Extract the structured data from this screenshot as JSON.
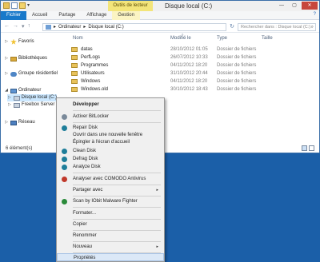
{
  "titlebar": {
    "context_tab": "Outils de lecteur",
    "title": "Disque local (C:)",
    "min": "—",
    "max": "▢",
    "close": "✕",
    "qa_drop": "▾"
  },
  "ribbon": {
    "tabs": [
      "Fichier",
      "Accueil",
      "Partage",
      "Affichage",
      "Gestion"
    ],
    "help": "?"
  },
  "address": {
    "back": "←",
    "forward": "→",
    "dropdown": "▾",
    "up": "↑",
    "path": [
      "Ordinateur",
      "Disque local (C:)"
    ],
    "separator": "▸",
    "refresh": "↻",
    "search_placeholder": "Rechercher dans : Disque local (C:)",
    "search_icon": "⌕"
  },
  "navpane": {
    "items": [
      {
        "chevron": "▷",
        "label": "Favoris",
        "icon": "star-icon"
      },
      {
        "chevron": "▷",
        "label": "Bibliothèques",
        "icon": "library-icon"
      },
      {
        "chevron": "▷",
        "label": "Groupe résidentiel",
        "icon": "homegroup-icon"
      },
      {
        "chevron": "◢",
        "label": "Ordinateur",
        "icon": "computer-icon"
      },
      {
        "chevron": "▷",
        "label": "Disque local (C:)",
        "icon": "drive-icon",
        "selected": true
      },
      {
        "chevron": "▷",
        "label": "Freebox Server",
        "icon": "network-drive-icon"
      },
      {
        "chevron": "▷",
        "label": "Réseau",
        "icon": "network-icon"
      }
    ]
  },
  "filelist": {
    "columns": [
      "Nom",
      "Modifié le",
      "Type",
      "Taille"
    ],
    "sort_arrow": "^",
    "rows": [
      {
        "name": "datas",
        "modified": "28/10/2012 01:05",
        "type": "Dossier de fichiers"
      },
      {
        "name": "PerfLogs",
        "modified": "26/07/2012 10:33",
        "type": "Dossier de fichiers"
      },
      {
        "name": "Programmes",
        "modified": "04/11/2012 18:20",
        "type": "Dossier de fichiers"
      },
      {
        "name": "Utilisateurs",
        "modified": "31/10/2012 20:44",
        "type": "Dossier de fichiers"
      },
      {
        "name": "Windows",
        "modified": "04/11/2012 18:20",
        "type": "Dossier de fichiers"
      },
      {
        "name": "Windows.old",
        "modified": "30/10/2012 18:43",
        "type": "Dossier de fichiers"
      }
    ]
  },
  "status": {
    "count": "6 élément(s)"
  },
  "context_menu": {
    "items": [
      {
        "label": "Développer",
        "bold": true
      },
      {
        "label": "Activer BitLocker",
        "icon": "bitlocker-icon",
        "color": "#7a8a9a"
      },
      {
        "label": "Repair Disk",
        "icon": "repair-icon",
        "color": "#1e7e9a"
      },
      {
        "label": "Ouvrir dans une nouvelle fenêtre"
      },
      {
        "label": "Épingler à l'écran d'accueil"
      },
      {
        "label": "Clean Disk",
        "icon": "clean-icon",
        "color": "#1e7e9a"
      },
      {
        "label": "Defrag Disk",
        "icon": "defrag-icon",
        "color": "#1e7e9a"
      },
      {
        "label": "Analyze Disk",
        "icon": "analyze-icon",
        "color": "#1e7e9a"
      },
      {
        "label": "Analyser avec COMODO Antivirus",
        "icon": "comodo-icon",
        "color": "#c0392b"
      },
      {
        "label": "Partager avec",
        "submenu": true
      },
      {
        "label": "Scan by IObit Malware Fighter",
        "icon": "iobit-icon",
        "color": "#2a8a3a"
      },
      {
        "label": "Formater..."
      },
      {
        "label": "Copier"
      },
      {
        "label": "Renommer"
      },
      {
        "label": "Nouveau",
        "submenu": true
      },
      {
        "label": "Propriétés",
        "highlighted": true
      }
    ],
    "submenu_arrow": "▸"
  }
}
